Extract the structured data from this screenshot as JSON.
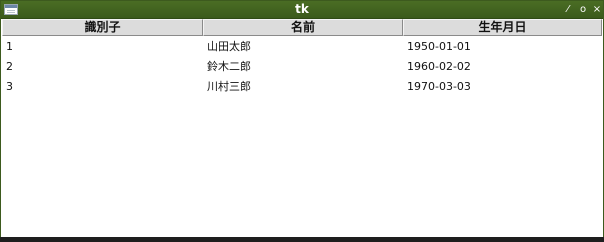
{
  "window": {
    "title": "tk",
    "controls": {
      "minimize": "⁄",
      "maximize": "o",
      "close": "×"
    }
  },
  "table": {
    "columns": [
      "識別子",
      "名前",
      "生年月日"
    ],
    "rows": [
      [
        "1",
        "山田太郎",
        "1950-01-01"
      ],
      [
        "2",
        "鈴木二郎",
        "1960-02-02"
      ],
      [
        "3",
        "川村三郎",
        "1970-03-03"
      ]
    ]
  }
}
